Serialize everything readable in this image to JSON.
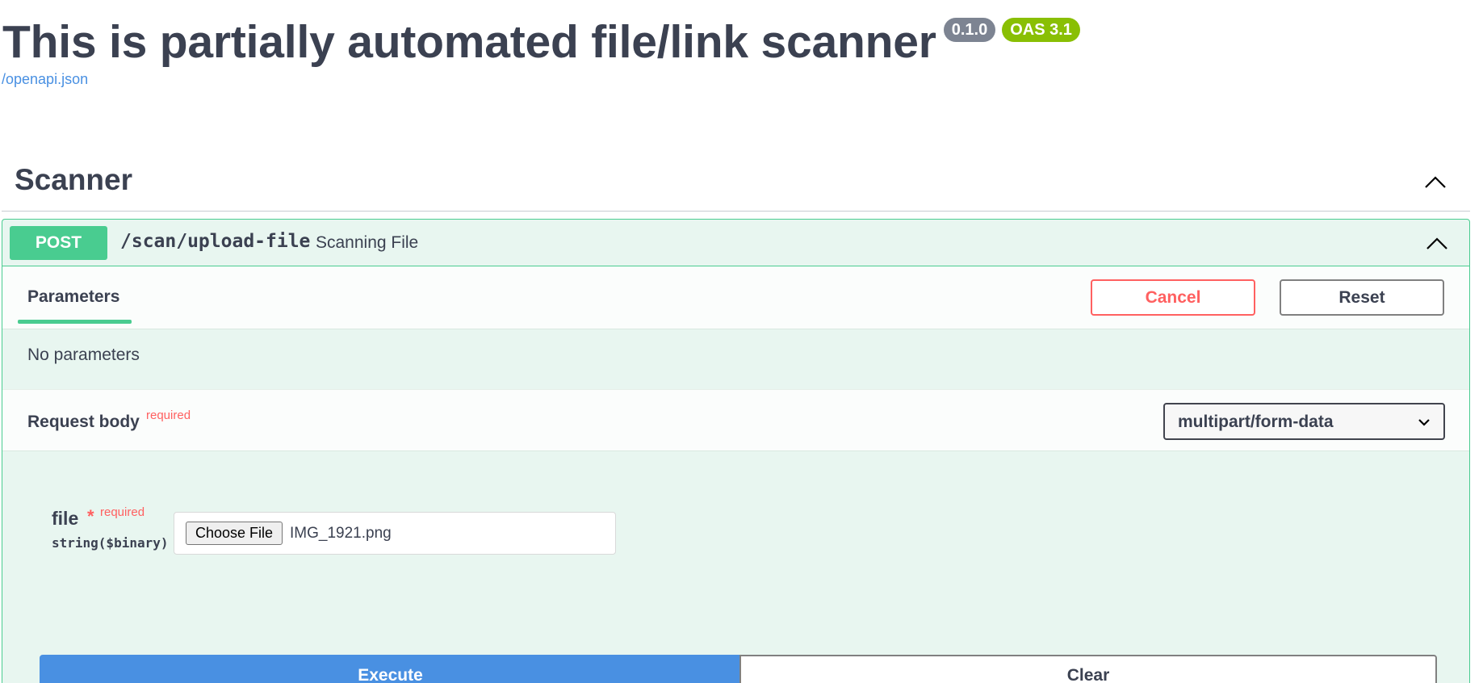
{
  "header": {
    "title": "This is partially automated file/link scanner",
    "version_badge": "0.1.0",
    "oas_badge": "OAS 3.1",
    "spec_link": "/openapi.json"
  },
  "section": {
    "title": "Scanner",
    "toggle_icon": "chevron-up-icon"
  },
  "operation": {
    "method": "POST",
    "path": "/scan/upload-file",
    "summary": "Scanning File",
    "toggle_icon": "chevron-up-icon",
    "colors": {
      "method_bg": "#49cc90",
      "block_bg": "#e8f6f0",
      "border": "#49cc90"
    }
  },
  "parameters": {
    "tab_label": "Parameters",
    "cancel_label": "Cancel",
    "reset_label": "Reset",
    "empty_text": "No parameters"
  },
  "request_body": {
    "label": "Request body",
    "required_text": "required",
    "content_type": "multipart/form-data",
    "dropdown_icon": "chevron-down-icon"
  },
  "file_field": {
    "name": "file",
    "star": "*",
    "required_text": "required",
    "type": "string($binary)",
    "choose_button": "Choose File",
    "selected_file": "IMG_1921.png"
  },
  "actions": {
    "execute_label": "Execute",
    "clear_label": "Clear",
    "execute_color": "#4990e2"
  }
}
